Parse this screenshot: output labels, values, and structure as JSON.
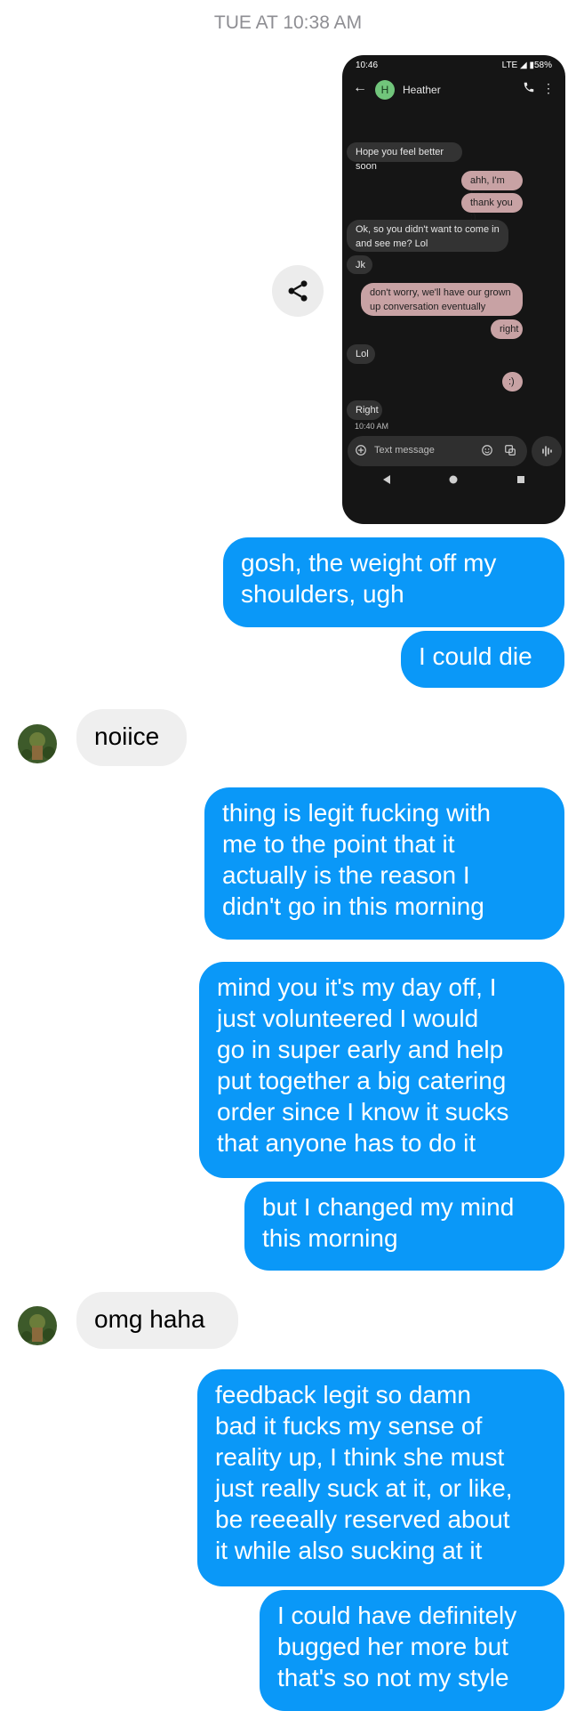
{
  "timestamp": "TUE AT 10:38 AM",
  "screenshot": {
    "status_time": "10:46",
    "status_right": "LTE ◢ ▮58%",
    "contact_initial": "H",
    "contact_name": "Heather",
    "messages": [
      {
        "dir": "in",
        "text": "Hope you feel better soon"
      },
      {
        "dir": "out",
        "text": "ahh, I'm fine"
      },
      {
        "dir": "out",
        "text": "thank you  :)"
      },
      {
        "dir": "in",
        "text": "Ok, so you didn't want to come in and see me? Lol"
      },
      {
        "dir": "in",
        "text": "Jk"
      },
      {
        "dir": "out",
        "text": "don't worry, we'll have our grown up conversation eventually"
      },
      {
        "dir": "out",
        "text": "right"
      },
      {
        "dir": "in",
        "text": "Lol"
      },
      {
        "dir": "out",
        "text": ":)"
      },
      {
        "dir": "in",
        "text": "Right"
      }
    ],
    "last_time": "10:40 AM",
    "compose_placeholder": "Text message"
  },
  "thread": [
    {
      "dir": "out",
      "text": "gosh, the weight off my\nshoulders, ugh"
    },
    {
      "dir": "out",
      "text": "I could die"
    },
    {
      "dir": "in",
      "text": "noiice"
    },
    {
      "dir": "out",
      "text": "thing is legit fucking with\nme to the point that it\nactually is the reason I\ndidn't go in this morning"
    },
    {
      "dir": "out",
      "text": "mind you it's my day off, I\njust volunteered I would\ngo in super early and help\nput together a big catering\norder since I know it sucks\nthat anyone has to do it"
    },
    {
      "dir": "out",
      "text": "but I changed my mind\nthis morning"
    },
    {
      "dir": "in",
      "text": "omg haha"
    },
    {
      "dir": "out",
      "text": "feedback legit so damn\nbad it fucks my sense of\nreality up, I think she must\njust really suck at it, or like,\nbe reeeally reserved about\nit while also sucking at it"
    },
    {
      "dir": "out",
      "text": "I could have definitely\nbugged her more but\nthat's so not my style"
    }
  ],
  "colors": {
    "outgoing": "#0a98f8",
    "incoming": "#efefef",
    "shot_out": "#c8a2a4",
    "shot_in": "#333333"
  },
  "icons": [
    "share-icon",
    "back-arrow-icon",
    "phone-icon",
    "more-vert-icon",
    "add-icon",
    "emoji-icon",
    "attach-icon",
    "voice-icon",
    "nav-back-icon",
    "nav-home-icon",
    "nav-recents-icon"
  ]
}
